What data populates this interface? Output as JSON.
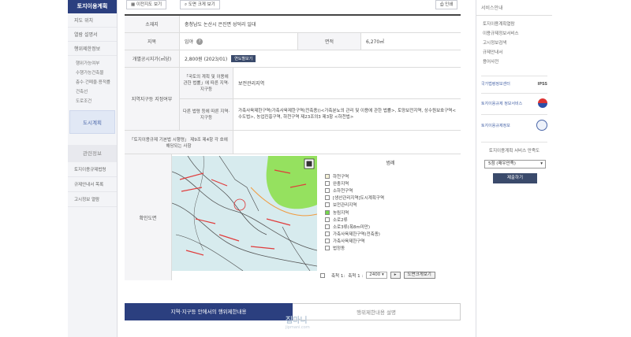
{
  "left_sidebar": {
    "title": "토지이용계획",
    "items": [
      "지도 위치",
      "열람 설명서",
      "행위제한정보"
    ],
    "sub_items": [
      "행위가능여부",
      "수행가능건축물",
      "층수·건폐율·용적률",
      "건축선",
      "도로조건"
    ],
    "active": "도시계획",
    "section": "관련정보",
    "links": [
      "토지이용규제법령",
      "규제안내서 목록",
      "고시정보 열람"
    ]
  },
  "toolbar": {
    "btn1": "이전지도 보기",
    "btn2": "도면 크게 보기",
    "print": "인쇄"
  },
  "table": {
    "row1_label": "소재지",
    "row1_value": "충청남도 논산시 은진면 성덕리 일대",
    "row2_label": "지목",
    "row2_value": "임야",
    "row2_help": "?",
    "row2_label_b": "면적",
    "row2_value_b": "6,270㎡",
    "row3_label": "개별공시지가(㎡당)",
    "row3_value": "2,800원 (2023/01)",
    "row3_tag": "연도별보기",
    "group_label": "지역지구등 지정여부",
    "sub1_label": "「국토의 계획 및 이용에 관한 법률」에 따른 지역·지구등",
    "sub1_value": "보전관리지역",
    "sub2_label": "다른 법령 등에 따른 지역·지구등",
    "sub2_value": "가축사육제한구역(가축사육제한구역(전축종))<가축분뇨의 관리 및 이용에 관한 법률>, 토양보전지역, 상수원보호구역<수도법>, 농업진흥구역, 하천구역 제23조의3 제3항 <하천법>",
    "row5_label": "「토지이용규제 기본법 시행령」 제9조 제4항 각 호에 해당되는 사항",
    "map_label": "확인도면"
  },
  "legend": {
    "title": "범례",
    "items": [
      {
        "label": "하천구역",
        "color": "#f6f2d6"
      },
      {
        "label": "완충지역",
        "color": "#ffffff"
      },
      {
        "label": "소하천구역",
        "color": "#ffffff"
      },
      {
        "label": "[생산관리지역]도시계획구역",
        "color": "#ffffff"
      },
      {
        "label": "보전관리지역",
        "color": "#ffffff"
      },
      {
        "label": "농림지역",
        "color": "#74d84a"
      },
      {
        "label": "소로2류",
        "color": "#ffffff"
      },
      {
        "label": "소로3류(폭8m미만)",
        "color": "#ffffff"
      },
      {
        "label": "가축사육제한구역(전축종)",
        "color": "#ffffff"
      },
      {
        "label": "가축사육제한구역",
        "color": "#ffffff"
      },
      {
        "label": "법정동",
        "color": "#ffffff"
      }
    ]
  },
  "map_controls": {
    "checkbox_label": "축척 1:",
    "scale_label": "축척 1 :",
    "scale_value": "2400",
    "btn": "도면크게보기"
  },
  "bottom_tabs": {
    "tab1": "지역·지구등 안에서의 행위제한내용",
    "tab2": "행위제한내용 설명"
  },
  "right_sidebar": {
    "title": "서비스안내",
    "links": [
      "토지이용계획열람",
      "이용규제정보서비스",
      "고시정보검색",
      "규제안내서",
      "용어사전"
    ],
    "card1": "국가법령정보센터",
    "card1_b": "IPSS",
    "card2": "토지이용규제 정보서비스",
    "card3": "토지이용규제정보",
    "question": "토지이용계획 서비스 만족도",
    "select_value": "5점 (매우만족)",
    "btn": "제출하기"
  },
  "watermark": {
    "main": "집마니",
    "sub": "jipmani.com"
  }
}
